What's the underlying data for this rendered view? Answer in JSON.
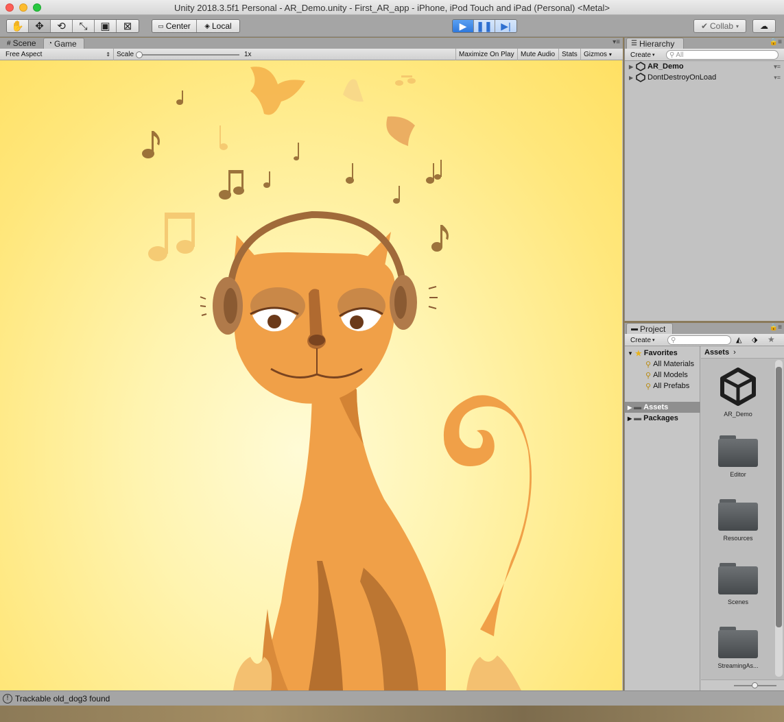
{
  "window": {
    "title": "Unity 2018.3.5f1 Personal - AR_Demo.unity - First_AR_app - iPhone, iPod Touch and iPad (Personal) <Metal>"
  },
  "toolbar": {
    "tools": [
      "hand-tool",
      "move-tool",
      "rotate-tool",
      "scale-tool",
      "rect-tool",
      "transform-tool"
    ],
    "pivot_label": "Center",
    "space_label": "Local",
    "collab_label": "Collab"
  },
  "game_panel": {
    "tabs": [
      {
        "label": "Scene"
      },
      {
        "label": "Game"
      }
    ],
    "aspect_label": "Free Aspect",
    "scale_label": "Scale",
    "scale_value": "1x",
    "scale_fraction": 0.0,
    "maximize_label": "Maximize On Play",
    "mute_label": "Mute Audio",
    "stats_label": "Stats",
    "gizmos_label": "Gizmos"
  },
  "hierarchy": {
    "tab_label": "Hierarchy",
    "create_label": "Create",
    "search_placeholder": "All",
    "items": [
      {
        "label": "AR_Demo"
      },
      {
        "label": "DontDestroyOnLoad"
      }
    ]
  },
  "project": {
    "tab_label": "Project",
    "create_label": "Create",
    "favorites_label": "Favorites",
    "favorites": [
      {
        "label": "All Materials"
      },
      {
        "label": "All Models"
      },
      {
        "label": "All Prefabs"
      }
    ],
    "tree": [
      {
        "label": "Assets"
      },
      {
        "label": "Packages"
      }
    ],
    "breadcrumb": "Assets",
    "assets": [
      {
        "label": "AR_Demo"
      },
      {
        "label": "Editor"
      },
      {
        "label": "Resources"
      },
      {
        "label": "Scenes"
      },
      {
        "label": "StreamingAs..."
      }
    ]
  },
  "status": {
    "message": "Trackable old_dog3 found"
  }
}
